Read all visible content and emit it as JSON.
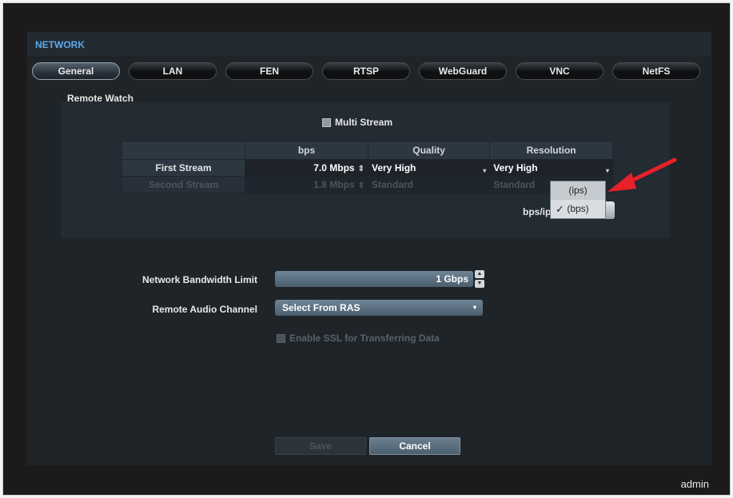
{
  "window": {
    "title": "NETWORK"
  },
  "tabs": [
    {
      "label": "General",
      "active": true
    },
    {
      "label": "LAN",
      "active": false
    },
    {
      "label": "FEN",
      "active": false
    },
    {
      "label": "RTSP",
      "active": false
    },
    {
      "label": "WebGuard",
      "active": false
    },
    {
      "label": "VNC",
      "active": false
    },
    {
      "label": "NetFS",
      "active": false
    }
  ],
  "remote_watch": {
    "section_label": "Remote Watch",
    "multi_stream_label": "Multi Stream",
    "columns": [
      "",
      "bps",
      "Quality",
      "Resolution"
    ],
    "rows": [
      {
        "name": "First Stream",
        "bps": "7.0 Mbps",
        "quality": "Very High",
        "resolution": "Very High",
        "enabled": true
      },
      {
        "name": "Second Stream",
        "bps": "1.8 Mbps",
        "quality": "Standard",
        "resolution": "Standard",
        "enabled": false
      }
    ],
    "bps_ips_label": "bps/ip",
    "dropdown_options": [
      {
        "label": "(ips)",
        "selected": false
      },
      {
        "label": "(bps)",
        "selected": true
      }
    ]
  },
  "network": {
    "bandwidth_label": "Network Bandwidth Limit",
    "bandwidth_value": "1 Gbps",
    "audio_label": "Remote Audio Channel",
    "audio_value": "Select From RAS",
    "ssl_label": "Enable SSL for Transferring Data"
  },
  "buttons": {
    "save": "Save",
    "cancel": "Cancel"
  },
  "user": "admin",
  "colors": {
    "accent_title": "#5aa9ea",
    "annotation_arrow": "#e8202a"
  }
}
